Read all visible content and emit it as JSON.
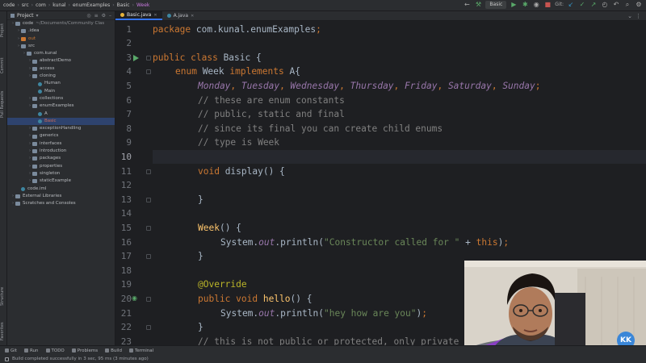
{
  "window": {
    "breadcrumbs": [
      "code",
      "src",
      "com",
      "kunal",
      "enumExamples",
      "Basic",
      "Week"
    ],
    "run_config": "Basic",
    "git_label": "Git:"
  },
  "sidebar": {
    "project_label": "Project",
    "commit_label": "Commit",
    "pull_requests_label": "Pull Requests",
    "structure_label": "Structure",
    "favorites_label": "Favorites",
    "tree": [
      {
        "depth": 0,
        "label": "code",
        "hint": "~/Documents/Community Clas",
        "type": "folder"
      },
      {
        "depth": 1,
        "label": ".idea",
        "type": "folder"
      },
      {
        "depth": 1,
        "label": "out",
        "type": "folder",
        "style": "orange"
      },
      {
        "depth": 1,
        "label": "src",
        "type": "folder"
      },
      {
        "depth": 2,
        "label": "com.kunal",
        "type": "folder"
      },
      {
        "depth": 3,
        "label": "abstractDemo",
        "type": "folder"
      },
      {
        "depth": 3,
        "label": "access",
        "type": "folder"
      },
      {
        "depth": 3,
        "label": "cloning",
        "type": "folder"
      },
      {
        "depth": 4,
        "label": "Human",
        "type": "file"
      },
      {
        "depth": 4,
        "label": "Main",
        "type": "file"
      },
      {
        "depth": 3,
        "label": "collections",
        "type": "folder"
      },
      {
        "depth": 3,
        "label": "enumExamples",
        "type": "folder"
      },
      {
        "depth": 4,
        "label": "A",
        "type": "file"
      },
      {
        "depth": 4,
        "label": "Basic",
        "type": "file",
        "selected": true,
        "style": "red"
      },
      {
        "depth": 3,
        "label": "exceptionHandling",
        "type": "folder"
      },
      {
        "depth": 3,
        "label": "generics",
        "type": "folder"
      },
      {
        "depth": 3,
        "label": "interfaces",
        "type": "folder"
      },
      {
        "depth": 3,
        "label": "introduction",
        "type": "folder"
      },
      {
        "depth": 3,
        "label": "packages",
        "type": "folder"
      },
      {
        "depth": 3,
        "label": "properties",
        "type": "folder"
      },
      {
        "depth": 3,
        "label": "singleton",
        "type": "folder"
      },
      {
        "depth": 3,
        "label": "staticExample",
        "type": "folder"
      },
      {
        "depth": 1,
        "label": "code.iml",
        "type": "file"
      },
      {
        "depth": 0,
        "label": "External Libraries",
        "type": "folder"
      },
      {
        "depth": 0,
        "label": "Scratches and Consoles",
        "type": "folder"
      }
    ]
  },
  "tabs": [
    {
      "label": "Basic.java",
      "active": true
    },
    {
      "label": "A.java",
      "active": false
    }
  ],
  "editor": {
    "current_line": 10,
    "lines": [
      {
        "n": 1,
        "indent": 0,
        "tokens": [
          [
            "kw",
            "package "
          ],
          [
            "txt",
            "com.kunal.enumExamples"
          ],
          [
            "punc",
            ";"
          ]
        ]
      },
      {
        "n": 2,
        "indent": 0,
        "tokens": []
      },
      {
        "n": 3,
        "indent": 0,
        "run": true,
        "tokens": [
          [
            "kw",
            "public class "
          ],
          [
            "txt",
            "Basic {"
          ]
        ]
      },
      {
        "n": 4,
        "indent": 1,
        "tokens": [
          [
            "kw",
            "enum "
          ],
          [
            "txt",
            "Week "
          ],
          [
            "kw",
            "implements "
          ],
          [
            "txt",
            "A{"
          ]
        ]
      },
      {
        "n": 5,
        "indent": 2,
        "tokens": [
          [
            "enumc",
            "Monday"
          ],
          [
            "punc",
            ", "
          ],
          [
            "enumc",
            "Tuesday"
          ],
          [
            "punc",
            ", "
          ],
          [
            "enumc",
            "Wednesday"
          ],
          [
            "punc",
            ", "
          ],
          [
            "enumc",
            "Thursday"
          ],
          [
            "punc",
            ", "
          ],
          [
            "enumc",
            "Friday"
          ],
          [
            "punc",
            ", "
          ],
          [
            "enumc",
            "Saturday"
          ],
          [
            "punc",
            ", "
          ],
          [
            "enumc",
            "Sunday"
          ],
          [
            "punc",
            ";"
          ]
        ]
      },
      {
        "n": 6,
        "indent": 2,
        "tokens": [
          [
            "cm",
            "// these are enum constants"
          ]
        ]
      },
      {
        "n": 7,
        "indent": 2,
        "tokens": [
          [
            "cm",
            "// public, static and final"
          ]
        ]
      },
      {
        "n": 8,
        "indent": 2,
        "tokens": [
          [
            "cm",
            "// since its final you can create child enums"
          ]
        ]
      },
      {
        "n": 9,
        "indent": 2,
        "tokens": [
          [
            "cm",
            "// type is Week"
          ]
        ]
      },
      {
        "n": 10,
        "indent": 0,
        "tokens": []
      },
      {
        "n": 11,
        "indent": 2,
        "tokens": [
          [
            "kw",
            "void "
          ],
          [
            "txt",
            "display() {"
          ]
        ]
      },
      {
        "n": 12,
        "indent": 0,
        "tokens": []
      },
      {
        "n": 13,
        "indent": 2,
        "tokens": [
          [
            "txt",
            "}"
          ]
        ]
      },
      {
        "n": 14,
        "indent": 0,
        "tokens": []
      },
      {
        "n": 15,
        "indent": 2,
        "tokens": [
          [
            "fn",
            "Week"
          ],
          [
            "txt",
            "() {"
          ]
        ]
      },
      {
        "n": 16,
        "indent": 3,
        "tokens": [
          [
            "txt",
            "System."
          ],
          [
            "fld",
            "out"
          ],
          [
            "txt",
            ".println("
          ],
          [
            "str",
            "\"Constructor called for \""
          ],
          [
            "txt",
            " + "
          ],
          [
            "kw",
            "this"
          ],
          [
            "txt",
            ")"
          ],
          [
            "punc",
            ";"
          ]
        ]
      },
      {
        "n": 17,
        "indent": 2,
        "tokens": [
          [
            "txt",
            "}"
          ]
        ]
      },
      {
        "n": 18,
        "indent": 0,
        "tokens": []
      },
      {
        "n": 19,
        "indent": 2,
        "tokens": [
          [
            "ann",
            "@Override"
          ]
        ]
      },
      {
        "n": 20,
        "indent": 2,
        "override": true,
        "tokens": [
          [
            "kw",
            "public void "
          ],
          [
            "fn",
            "hello"
          ],
          [
            "txt",
            "() {"
          ]
        ]
      },
      {
        "n": 21,
        "indent": 3,
        "tokens": [
          [
            "txt",
            "System."
          ],
          [
            "fld",
            "out"
          ],
          [
            "txt",
            ".println("
          ],
          [
            "str",
            "\"hey how are you\""
          ],
          [
            "txt",
            ")"
          ],
          [
            "punc",
            ";"
          ]
        ]
      },
      {
        "n": 22,
        "indent": 2,
        "tokens": [
          [
            "txt",
            "}"
          ]
        ]
      },
      {
        "n": 23,
        "indent": 2,
        "tokens": [
          [
            "cm",
            "// this is not public or protected, only private"
          ]
        ]
      }
    ]
  },
  "bottom_tools": [
    "Git",
    "Run",
    "TODO",
    "Problems",
    "Build",
    "Terminal"
  ],
  "status": {
    "message": "Build completed successfully in 3 sec, 95 ms (3 minutes ago)"
  },
  "webcam": {
    "logo": "KK"
  }
}
